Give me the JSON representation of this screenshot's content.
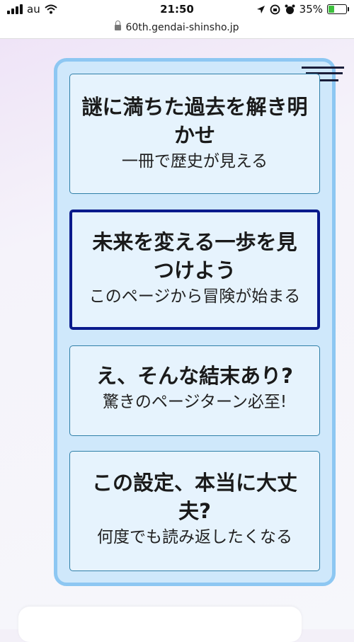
{
  "status_bar": {
    "carrier": "au",
    "time": "21:50",
    "battery_percent": "35%",
    "battery_level": 0.35
  },
  "browser": {
    "url": "60th.gendai-shinsho.jp"
  },
  "menu": {
    "icon": "hamburger-menu-icon"
  },
  "cards": [
    {
      "title": "謎に満ちた過去を解き明かせ",
      "subtitle": "一冊で歴史が見える"
    },
    {
      "title": "未来を変える一歩を見つけよう",
      "subtitle": "このページから冒険が始まる"
    },
    {
      "title": "え、そんな結末あり?",
      "subtitle": "驚きのページターン必至!"
    },
    {
      "title": "この設定、本当に大丈夫?",
      "subtitle": "何度でも読み返したくなる"
    }
  ],
  "colors": {
    "panel_bg": "#cfe8fb",
    "panel_border": "#8dc7f2",
    "card_bg": "#e6f3fd",
    "active_border": "#0a1a8c"
  }
}
